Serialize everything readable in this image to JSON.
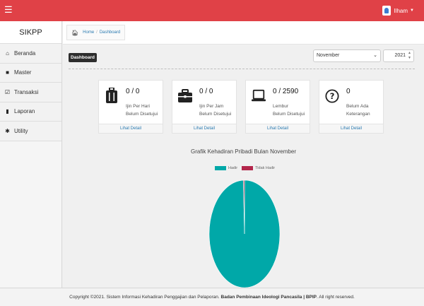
{
  "topbar": {
    "menu_icon": "hamburger-icon",
    "user_name": "Ilham",
    "user_icon": "user-avatar-icon"
  },
  "sidebar": {
    "brand": "SIKPP",
    "items": [
      {
        "label": "Beranda",
        "icon": "home-icon"
      },
      {
        "label": "Master",
        "icon": "book-icon"
      },
      {
        "label": "Transaksi",
        "icon": "check-square-icon"
      },
      {
        "label": "Laporan",
        "icon": "file-icon"
      },
      {
        "label": "Utility",
        "icon": "gear-icon"
      }
    ]
  },
  "breadcrumb": {
    "home": "Home",
    "current": "Dashboard"
  },
  "toolbar": {
    "badge": "Dashboard",
    "month": "November",
    "year": "2021"
  },
  "cards": [
    {
      "value": "0 / 0",
      "line1": "Ijin Per Hari",
      "line2": "Belum Disetujui",
      "link": "Lihat Detail",
      "icon": "luggage-icon"
    },
    {
      "value": "0 / 0",
      "line1": "Ijin Per Jam",
      "line2": "Belum Disetujui",
      "link": "Lihat Detail",
      "icon": "briefcase-icon"
    },
    {
      "value": "0 / 2590",
      "line1": "Lembur",
      "line2": "Belum Disetujui",
      "link": "Lihat Detail",
      "icon": "laptop-icon"
    },
    {
      "value": "0",
      "line1": "Belum Ada",
      "line2": "Keterangan",
      "link": "Lihat Detail",
      "icon": "question-circle-icon"
    }
  ],
  "chart_data": {
    "type": "pie",
    "title": "Grafik Kehadiran Pribadi Bulan November",
    "categories": [
      "Hadir",
      "Tidak Hadir"
    ],
    "values": [
      99.5,
      0.5
    ],
    "colors": [
      "#00a8a8",
      "#b3264b"
    ],
    "legend": "top"
  },
  "footer": {
    "text": "Copyright ©2021. Sistem Informasi Kehadiran Penggajian dan Pelaporan.",
    "org": "Badan Pembinaan Ideologi Pancasila | BPIP",
    "suffix": ". All right reserved."
  }
}
